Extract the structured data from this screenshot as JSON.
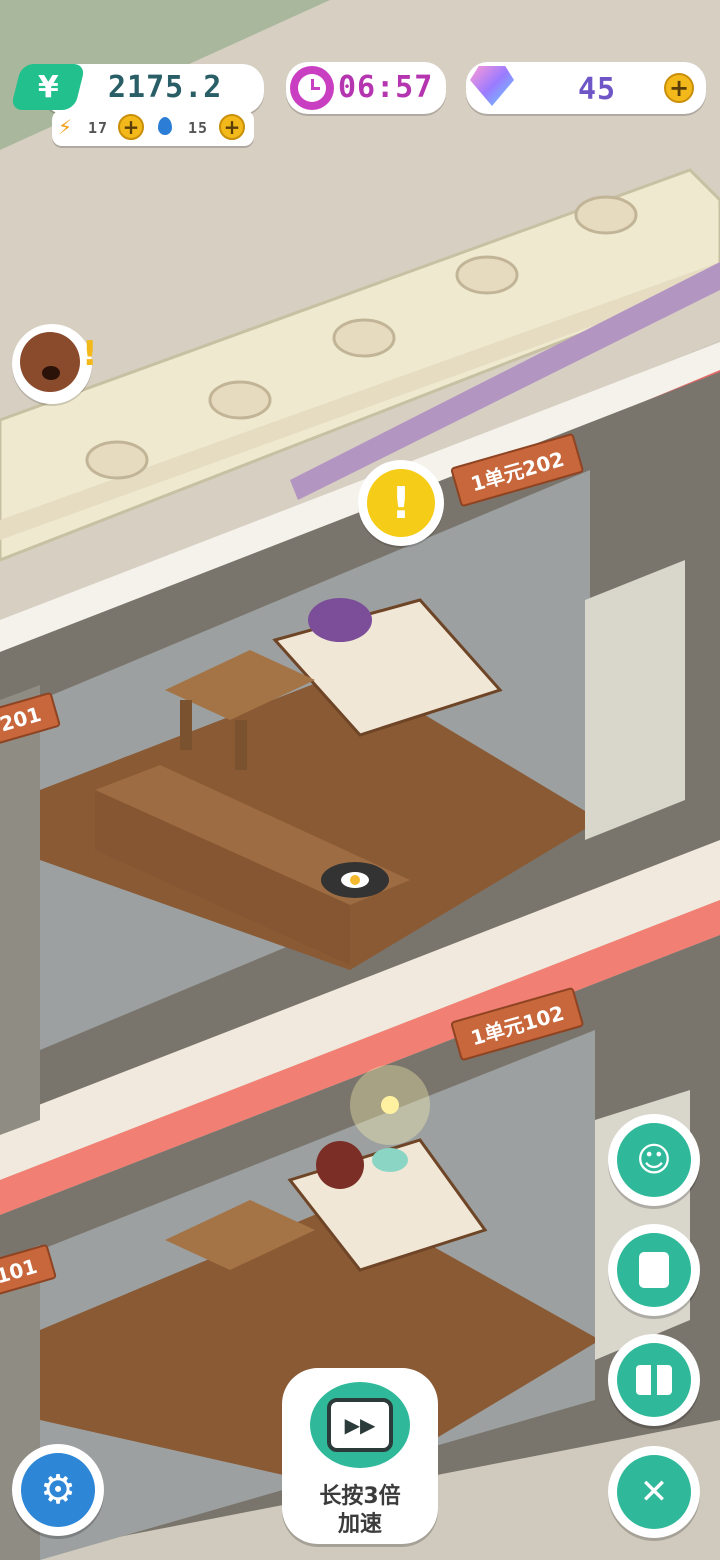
{
  "hud": {
    "money": "2175.2",
    "energy": "17",
    "water": "15",
    "timer": "06:57",
    "gems": "45"
  },
  "rooms": [
    {
      "id": "room-202",
      "label": "1单元202"
    },
    {
      "id": "room-201",
      "label": "201"
    },
    {
      "id": "room-102",
      "label": "1单元102"
    },
    {
      "id": "room-101",
      "label": "101"
    }
  ],
  "speed_button": {
    "line1": "长按3倍",
    "line2": "加速"
  },
  "icons": {
    "money": "yuan-icon",
    "energy": "lightning-icon",
    "water": "water-drop-icon",
    "clock": "clock-icon",
    "gem": "diamond-icon",
    "alert": "exclamation-icon",
    "face": "smile-icon",
    "tasks": "notes-icon",
    "gift": "gift-icon",
    "build": "tools-icon",
    "settings": "gear-icon",
    "speed": "tv-fast-forward-icon"
  },
  "colors": {
    "accent": "#2fb99a",
    "coin": "#f3b91b",
    "timer": "#c93fc2",
    "sign": "#c8673b"
  }
}
